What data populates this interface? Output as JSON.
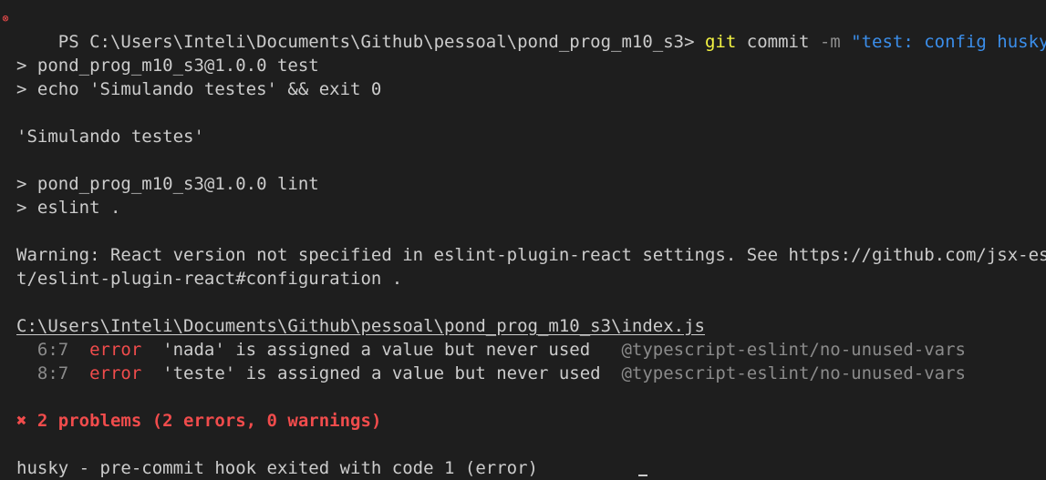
{
  "prompt": {
    "marker": "⊗",
    "ps": "PS C:\\Users\\Inteli\\Documents\\Github\\pessoal\\pond_prog_m10_s3> ",
    "cmd": "git",
    "sub": " commit ",
    "flag": "-m",
    "msg": " \"test: config husky\""
  },
  "lines": {
    "l1": "> pond_prog_m10_s3@1.0.0 test",
    "l2": "> echo 'Simulando testes' && exit 0",
    "l3": "'Simulando testes'",
    "l4": "> pond_prog_m10_s3@1.0.0 lint",
    "l5": "> eslint .",
    "l6": "Warning: React version not specified in eslint-plugin-react settings. See https://github.com/jsx-eslin",
    "l7": "t/eslint-plugin-react#configuration .",
    "file": "C:\\Users\\Inteli\\Documents\\Github\\pessoal\\pond_prog_m10_s3\\index.js"
  },
  "errors": [
    {
      "loc": "  6:7  ",
      "level": "error",
      "msg": "  'nada' is assigned a value but never used   ",
      "rule": "@typescript-eslint/no-unused-vars"
    },
    {
      "loc": "  8:7  ",
      "level": "error",
      "msg": "  'teste' is assigned a value but never used  ",
      "rule": "@typescript-eslint/no-unused-vars"
    }
  ],
  "summary": {
    "icon": "✖",
    "text": " 2 problems (2 errors, 0 warnings)"
  },
  "footer": "husky - pre-commit hook exited with code 1 (error)"
}
